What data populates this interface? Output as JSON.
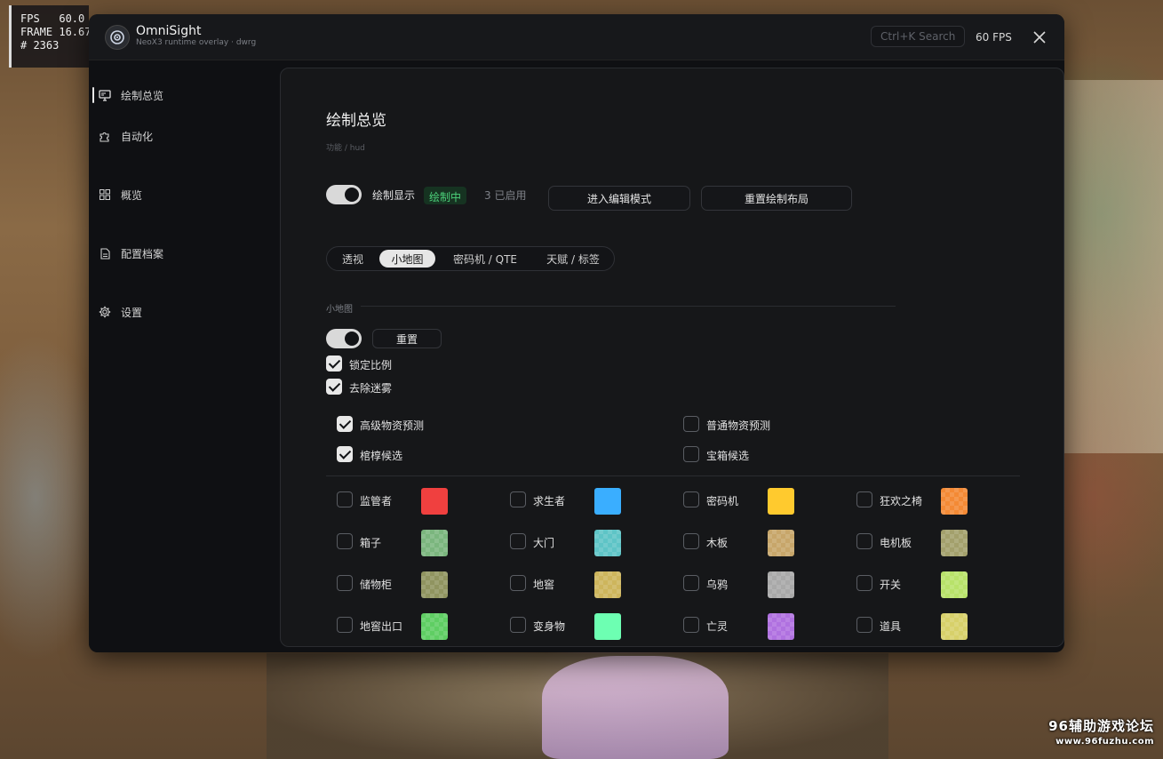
{
  "hud": {
    "fps_line": "FPS   60.0",
    "frame_line": "FRAME 16.67",
    "count_line": "# 2363"
  },
  "watermark": {
    "line1": "96辅助游戏论坛",
    "line2": "www.96fuzhu.com"
  },
  "window": {
    "app_name": "OmniSight",
    "app_subtitle": "NeoX3 runtime overlay · dwrg",
    "search_placeholder": "Ctrl+K  Search",
    "fps_readout": "60 FPS"
  },
  "sidebar": {
    "items": [
      {
        "label": "绘制总览",
        "icon": "monitor-icon",
        "active": true
      },
      {
        "label": "自动化",
        "icon": "puzzle-icon",
        "active": false
      },
      {
        "label": "概览",
        "icon": "grid-icon",
        "active": false
      },
      {
        "label": "配置档案",
        "icon": "file-icon",
        "active": false
      },
      {
        "label": "设置",
        "icon": "gear-icon",
        "active": false
      }
    ]
  },
  "main": {
    "title": "绘制总览",
    "breadcrumb": "功能 / hud",
    "draw_toggle_label": "绘制显示",
    "draw_status": "绘制中",
    "enabled_count": "3 已启用",
    "edit_mode_button": "进入编辑模式",
    "reset_layout_button": "重置绘制布局",
    "tabs": [
      "透视",
      "小地图",
      "密码机 / QTE",
      "天赋 / 标签"
    ],
    "active_tab": "小地图",
    "section_label": "小地图",
    "reset_button": "重置",
    "lock_ratio": "锁定比例",
    "remove_fog": "去除迷雾",
    "predict": [
      {
        "label": "高级物资预测",
        "checked": true
      },
      {
        "label": "普通物资预测",
        "checked": false
      },
      {
        "label": "棺椁候选",
        "checked": true
      },
      {
        "label": "宝箱候选",
        "checked": false
      }
    ],
    "items": [
      {
        "label": "监管者",
        "checked": false,
        "color": "#f0403f",
        "checker": false
      },
      {
        "label": "求生者",
        "checked": false,
        "color": "#3aaeff",
        "checker": false
      },
      {
        "label": "密码机",
        "checked": false,
        "color": "#ffca2e",
        "checker": false
      },
      {
        "label": "狂欢之椅",
        "checked": false,
        "color": "#f48a35",
        "checker": true
      },
      {
        "label": "箱子",
        "checked": false,
        "color": "#7bb67e",
        "checker": true
      },
      {
        "label": "大门",
        "checked": false,
        "color": "#5ec4c6",
        "checker": true
      },
      {
        "label": "木板",
        "checked": false,
        "color": "#c7a66a",
        "checker": true
      },
      {
        "label": "电机板",
        "checked": false,
        "color": "#a3a06c",
        "checker": true
      },
      {
        "label": "储物柜",
        "checked": false,
        "color": "#909460",
        "checker": true
      },
      {
        "label": "地窖",
        "checked": false,
        "color": "#cdb55c",
        "checker": true
      },
      {
        "label": "乌鸦",
        "checked": false,
        "color": "#a9a9a9",
        "checker": true
      },
      {
        "label": "开关",
        "checked": false,
        "color": "#b8e26a",
        "checker": true
      },
      {
        "label": "地窖出口",
        "checked": false,
        "color": "#5fce63",
        "checker": true
      },
      {
        "label": "变身物",
        "checked": false,
        "color": "#6dffb2",
        "checker": false
      },
      {
        "label": "亡灵",
        "checked": false,
        "color": "#b071e0",
        "checker": true
      },
      {
        "label": "道具",
        "checked": false,
        "color": "#d7d06a",
        "checker": true
      }
    ]
  }
}
